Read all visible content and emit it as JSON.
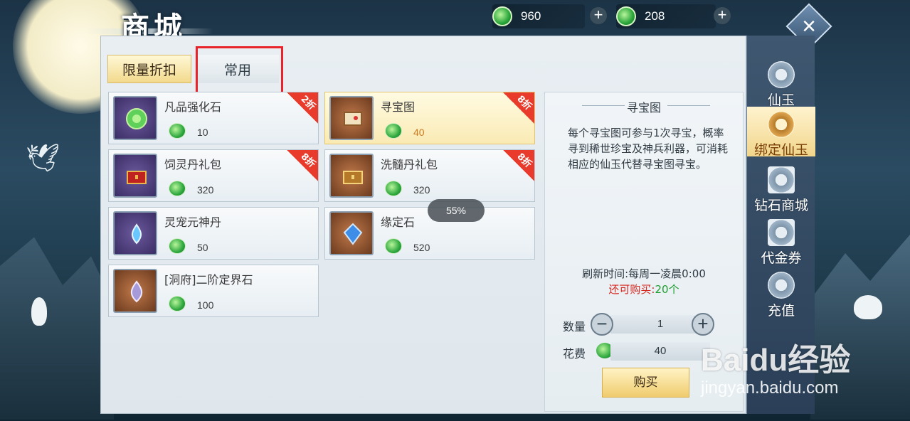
{
  "header": {
    "title": "商城",
    "currency_1": {
      "icon": "jade-icon",
      "value": "960"
    },
    "currency_2": {
      "icon": "bound-jade-icon",
      "value": "208"
    }
  },
  "tabs": [
    {
      "label": "限量折扣",
      "active": true
    },
    {
      "label": "常用",
      "active": false
    }
  ],
  "items": [
    {
      "name": "凡品强化石",
      "price": "10",
      "discount": "2折",
      "icon": "green-stone-icon"
    },
    {
      "name": "寻宝图",
      "price": "40",
      "discount": "8折",
      "icon": "treasure-map-icon",
      "selected": true
    },
    {
      "name": "饲灵丹礼包",
      "price": "320",
      "discount": "8折",
      "icon": "red-chest-icon"
    },
    {
      "name": "洗髓丹礼包",
      "price": "320",
      "discount": "8折",
      "icon": "gold-chest-icon"
    },
    {
      "name": "灵宠元神丹",
      "price": "50",
      "discount": "",
      "icon": "blue-orb-icon"
    },
    {
      "name": "缘定石",
      "price": "520",
      "discount": "",
      "icon": "blue-crystal-icon"
    },
    {
      "name": "[洞府]二阶定界石",
      "price": "100",
      "discount": "",
      "icon": "purple-crystal-icon"
    }
  ],
  "detail": {
    "title": "寻宝图",
    "description": "每个寻宝图可参与1次寻宝，概率寻到稀世珍宝及神兵利器，可消耗相应的仙玉代替寻宝图寻宝。",
    "refresh": "刷新时间:每周一凌晨0:00",
    "remain_label": "还可购买:",
    "remain_value": "20个",
    "qty_label": "数量",
    "qty_value": "1",
    "cost_label": "花费",
    "cost_value": "40",
    "buy_label": "购买"
  },
  "sidebar": [
    {
      "label": "仙玉",
      "icon": "jade-coin-icon",
      "active": false
    },
    {
      "label": "绑定仙玉",
      "icon": "bound-jade-coin-icon",
      "active": true
    },
    {
      "label": "钻石商城",
      "icon": "shop-building-icon",
      "active": false
    },
    {
      "label": "代金券",
      "icon": "voucher-icon",
      "active": false
    },
    {
      "label": "充值",
      "icon": "recharge-icon",
      "active": false
    }
  ],
  "toast": "55%",
  "watermark": {
    "brand": "Baidu经验",
    "url": "jingyan.baidu.com"
  },
  "colors": {
    "discount_badge": "#e83b2b",
    "selected_price": "#d0781a",
    "remain_text": "#d7261e",
    "remain_value": "#1f9d2e"
  }
}
